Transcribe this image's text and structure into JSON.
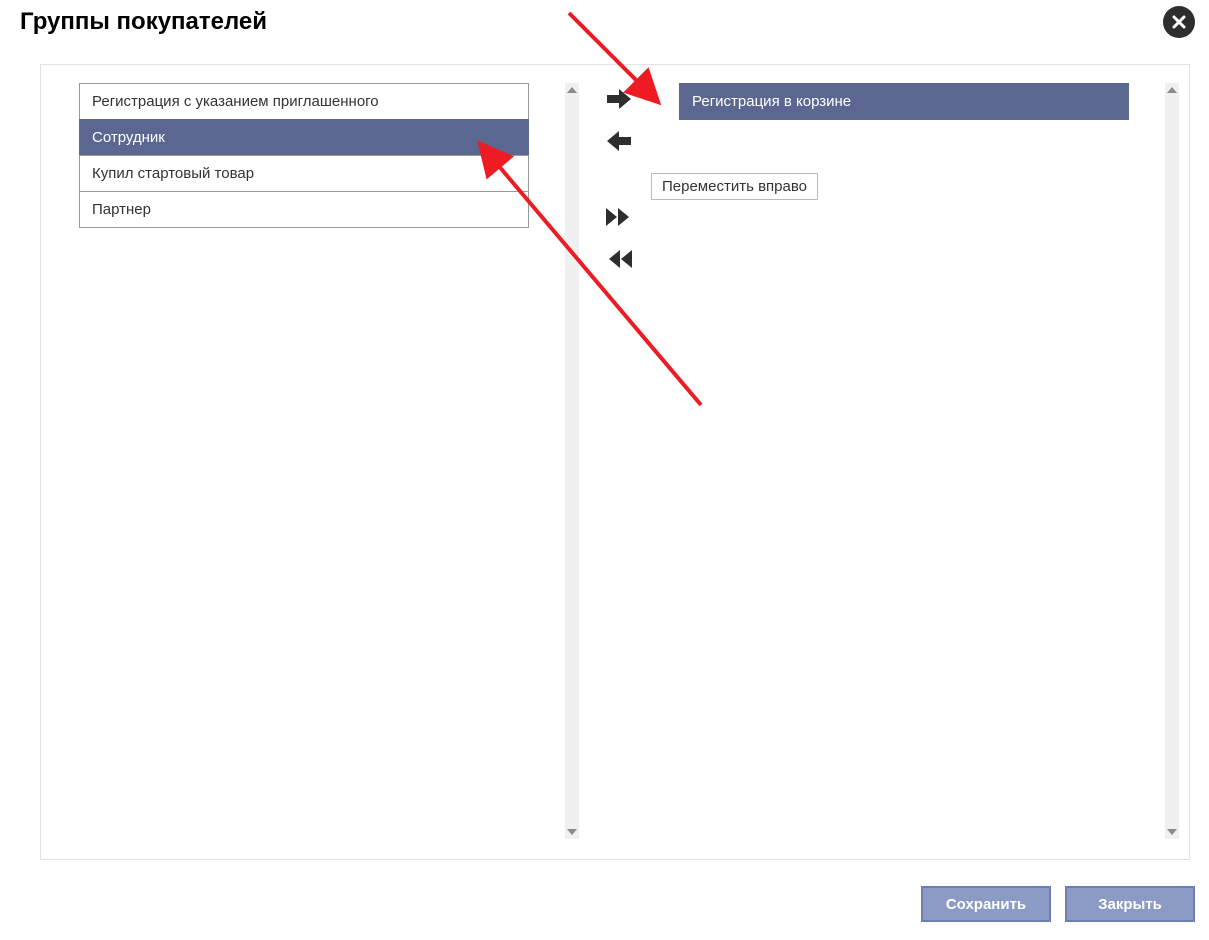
{
  "title": "Группы покупателей",
  "left_list": {
    "items": [
      {
        "label": "Регистрация с указанием приглашенного",
        "selected": false
      },
      {
        "label": "Сотрудник",
        "selected": true
      },
      {
        "label": "Купил стартовый товар",
        "selected": false
      },
      {
        "label": "Партнер",
        "selected": false
      }
    ]
  },
  "right_list": {
    "items": [
      {
        "label": "Регистрация в корзине",
        "selected": true
      }
    ]
  },
  "controls": {
    "move_right_tooltip": "Переместить вправо"
  },
  "footer": {
    "save_label": "Сохранить",
    "close_label": "Закрыть"
  },
  "colors": {
    "selection": "#5b6791",
    "button_bg": "#8b9bc5",
    "button_border": "#6d7fb3",
    "arrow": "#2e2e2e",
    "annotation": "#ed1c24"
  }
}
